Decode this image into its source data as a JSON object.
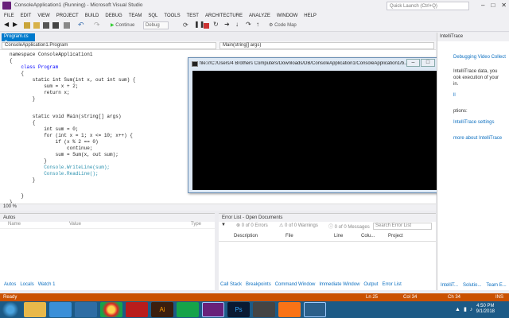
{
  "window": {
    "title": "ConsoleApplication1 (Running) - Microsoft Visual Studio",
    "quick_launch_placeholder": "Quick Launch (Ctrl+Q)"
  },
  "menu": [
    "FILE",
    "EDIT",
    "VIEW",
    "PROJECT",
    "BUILD",
    "DEBUG",
    "TEAM",
    "SQL",
    "TOOLS",
    "TEST",
    "ARCHITECTURE",
    "ANALYZE",
    "WINDOW",
    "HELP"
  ],
  "toolbar": {
    "continue_label": "Continue",
    "config": "Debug",
    "codemap_label": "Code Map"
  },
  "editor": {
    "tab_label": "Program.cs",
    "nav_left": "ConsoleApplication1.Program",
    "nav_right": "Main(string[] args)",
    "zoom": "100 %",
    "code": {
      "l1": "namespace ConsoleApplication1",
      "l2": "{",
      "l3": "    class Program",
      "l4": "    {",
      "l5": "        static int Sum(int x, out int sum) {",
      "l6": "            sum = x + 2;",
      "l7": "            return x;",
      "l8": "        }",
      "l9": "        static void Main(string[] args)",
      "l10": "        {",
      "l11": "            int sum = 0;",
      "l12": "            for (int x = 1; x <= 10; x++) {",
      "l13": "                if (x % 2 == 0)",
      "l14": "                    continue;",
      "l15": "                sum = Sum(x, out sum);",
      "l16": "            }",
      "l17": "            Console.WriteLine(sum);",
      "l18": "            Console.ReadLine();",
      "l19": "        }",
      "l20": "    }",
      "l21": "}"
    }
  },
  "console": {
    "title": "file:///C:/Users/4 Brothers Computers/Downloads/DB/ConsoleApplication1/ConsoleApplication1/b..."
  },
  "intellitrace": {
    "header": "IntelliTrace",
    "lines": [
      "Debugging Video Collect",
      "IntelliTrace data, you",
      "ook execution of your",
      "in.",
      "ll",
      "ptions:",
      "IntelliTrace settings",
      "more about IntelliTrace"
    ]
  },
  "autos": {
    "header": "Autos",
    "col_name": "Name",
    "col_value": "Value",
    "col_type": "Type",
    "tabs": [
      "Autos",
      "Locals",
      "Watch 1"
    ]
  },
  "errorlist": {
    "header": "Error List - Open Documents",
    "errors": "0 of 0 Errors",
    "warnings": "0 of 0 Warnings",
    "messages": "0 of 0 Messages",
    "search_placeholder": "Search Error List",
    "cols": [
      "Description",
      "File",
      "Line",
      "Colu...",
      "Project"
    ],
    "tabs": [
      "Call Stack",
      "Breakpoints",
      "Command Window",
      "Immediate Window",
      "Output",
      "Error List"
    ]
  },
  "right_tabs": [
    "IntelliT...",
    "Solutio...",
    "Team E..."
  ],
  "status": {
    "left": "Ready",
    "ln": "Ln 25",
    "col": "Col 34",
    "ch": "Ch 34",
    "mode": "INS"
  },
  "clock": {
    "time": "4:50 PM",
    "date": "9/1/2018"
  },
  "colors": {
    "accent": "#007acc",
    "status_bar": "#ca5100",
    "taskbar": "#1c5a86",
    "keyword": "#0000ff",
    "type": "#2b91af"
  }
}
